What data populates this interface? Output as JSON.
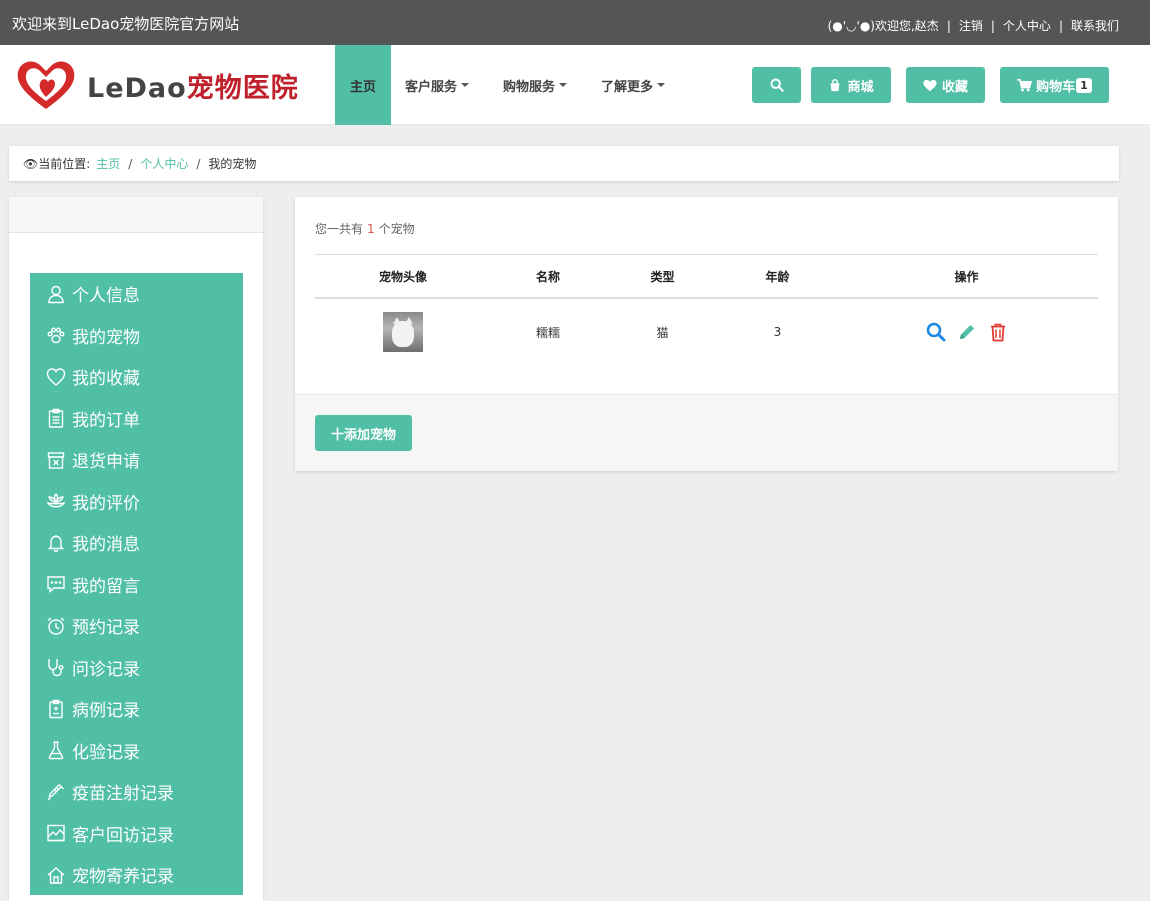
{
  "topbar": {
    "welcome": "欢迎来到LeDao宠物医院官方网站",
    "greeting": "(●'◡'●)欢迎您,赵杰",
    "logout": "注销",
    "user_center": "个人中心",
    "contact": "联系我们"
  },
  "logo": {
    "text_latin": "LeDao",
    "text_cn": "宠物医院"
  },
  "nav": {
    "items": [
      "主页",
      "客户服务",
      "购物服务",
      "了解更多"
    ],
    "mall": "商城",
    "favorites": "收藏",
    "cart": "购物车",
    "cart_count": "1"
  },
  "breadcrumb": {
    "prefix": "👁当前位置:",
    "items": [
      "主页",
      "个人中心",
      "我的宠物"
    ]
  },
  "sidebar": {
    "menu": [
      {
        "label": "个人信息",
        "icon": "user-icon"
      },
      {
        "label": "我的宠物",
        "icon": "paw-icon"
      },
      {
        "label": "我的收藏",
        "icon": "heart-icon"
      },
      {
        "label": "我的订单",
        "icon": "clipboard-icon"
      },
      {
        "label": "退货申请",
        "icon": "return-box-icon"
      },
      {
        "label": "我的评价",
        "icon": "flower-icon"
      },
      {
        "label": "我的消息",
        "icon": "bell-icon"
      },
      {
        "label": "我的留言",
        "icon": "chat-icon"
      },
      {
        "label": "预约记录",
        "icon": "alarm-clock-icon"
      },
      {
        "label": "问诊记录",
        "icon": "stethoscope-icon"
      },
      {
        "label": "病例记录",
        "icon": "medical-record-icon"
      },
      {
        "label": "化验记录",
        "icon": "flask-icon"
      },
      {
        "label": "疫苗注射记录",
        "icon": "syringe-icon"
      },
      {
        "label": "客户回访记录",
        "icon": "chart-icon"
      },
      {
        "label": "宠物寄养记录",
        "icon": "house-icon"
      }
    ]
  },
  "content": {
    "count_prefix": "您一共有",
    "count": "1",
    "count_suffix": "个宠物",
    "table": {
      "headers": [
        "宠物头像",
        "名称",
        "类型",
        "年龄",
        "操作"
      ],
      "rows": [
        {
          "name": "糯糯",
          "type": "猫",
          "age": "3"
        }
      ]
    },
    "add_button": "十添加宠物"
  },
  "colors": {
    "accent": "#50bfa5",
    "topbar": "#555555",
    "danger": "#e53935",
    "info": "#1e88e5"
  }
}
